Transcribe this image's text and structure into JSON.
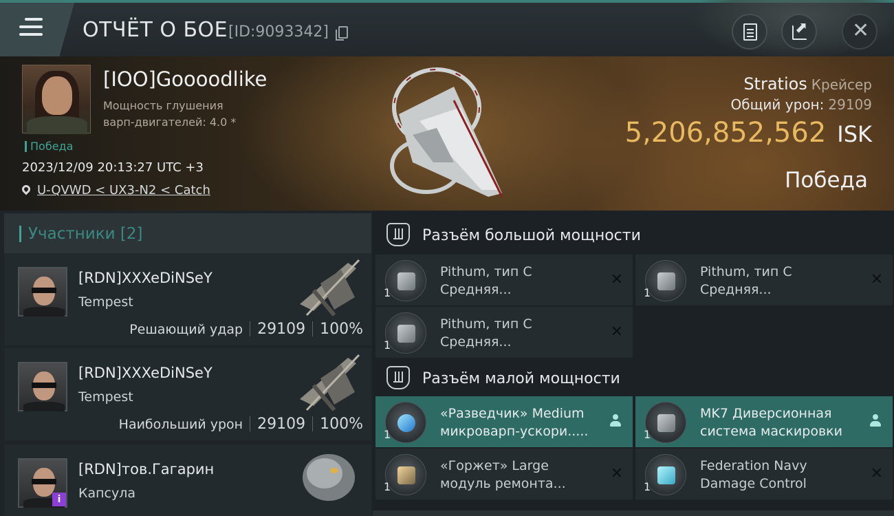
{
  "header": {
    "title": "ОТЧЁТ О БОЕ",
    "report_id": "[ID:9093342]"
  },
  "victim": {
    "pilot_name": "[IOO]Goooodlike",
    "stat_line1": "Мощность глушения",
    "stat_line2": "варп-двигателей: 4.0 *",
    "result_tag": "Победа",
    "datetime": "2023/12/09 20:13:27 UTC +3",
    "location": "U-QVWD < UX3-N2 < Catch",
    "ship_name": "Stratios",
    "ship_class": "Крейсер",
    "total_damage_label": "Общий урон:",
    "total_damage": "29109",
    "isk_value": "5,206,852,562",
    "isk_unit": "ISK",
    "outcome": "Победа"
  },
  "participants": {
    "header": "Участники [2]",
    "items": [
      {
        "name": "[RDN]XXXeDiNSeY",
        "ship": "Tempest",
        "role": "Решающий удар",
        "damage": "29109",
        "percent": "100%"
      },
      {
        "name": "[RDN]XXXeDiNSeY",
        "ship": "Tempest",
        "role": "Наибольший урон",
        "damage": "29109",
        "percent": "100%"
      },
      {
        "name": "[RDN]тов.Гагарин",
        "ship": "Капсула",
        "badge": "i"
      }
    ]
  },
  "fitting": {
    "high_slot_title": "Разъём большой мощности",
    "low_slot_title": "Разъём малой мощности",
    "high_modules": [
      {
        "qty": "1",
        "line1": "Pithum, тип C",
        "line2": "Средняя..."
      },
      {
        "qty": "1",
        "line1": "Pithum, тип C",
        "line2": "Средняя..."
      },
      {
        "qty": "1",
        "line1": "Pithum, тип C",
        "line2": "Средняя..."
      }
    ],
    "low_modules": [
      {
        "qty": "1",
        "line1": "«Разведчик» Medium",
        "line2": "микроварп-ускори.....",
        "state": "dropped"
      },
      {
        "qty": "1",
        "line1": "MK7 Диверсионная",
        "line2": "система маскировки",
        "state": "dropped"
      },
      {
        "qty": "1",
        "line1": "«Горжет» Large",
        "line2": "модуль ремонта...",
        "state": "destroyed"
      },
      {
        "qty": "1",
        "line1": "Federation Navy",
        "line2": "Damage Control",
        "state": "destroyed"
      }
    ]
  },
  "icons": {
    "destroyed_mark": "✕",
    "close": "✕"
  },
  "colors": {
    "accent_teal": "#3ea596",
    "isk_gold": "#e9b95f",
    "active_module": "#2f6b65"
  }
}
